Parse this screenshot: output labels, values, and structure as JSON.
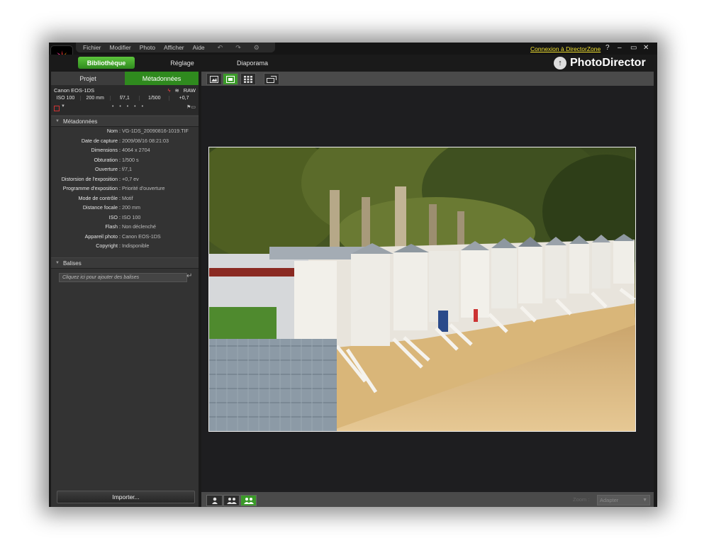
{
  "menu": [
    "Fichier",
    "Modifier",
    "Photo",
    "Afficher",
    "Aide"
  ],
  "title_link": "Connexion à DirectorZone",
  "window_controls": {
    "help": "?",
    "minimize": "–",
    "restore": "▭",
    "close": "✕"
  },
  "nav_tabs": [
    "Bibliothèque",
    "Réglage",
    "Diaporama"
  ],
  "brand": "PhotoDirector",
  "left_tabs": [
    "Projet",
    "Métadonnées"
  ],
  "camera": {
    "model": "Canon EOS-1DS",
    "format": "RAW",
    "params": [
      "ISO 100",
      "200 mm",
      "f/7,1",
      "1/500",
      "+0,7"
    ],
    "rating_dots": "• • • • •"
  },
  "sections": {
    "metadata": "Métadonnées",
    "tags": "Balises"
  },
  "metadata_rows": [
    {
      "label": "Nom :",
      "value": "VG-1DS_20090816-1019.TIF"
    },
    {
      "label": "Date de capture :",
      "value": "2009/08/16 08:21:03"
    },
    {
      "label": "Dimensions :",
      "value": "4064 x 2704"
    },
    {
      "label": "Obturation :",
      "value": "1/500 s"
    },
    {
      "label": "Ouverture :",
      "value": "f/7,1"
    },
    {
      "label": "Distorsion de l'exposition :",
      "value": "+0,7 ev"
    },
    {
      "label": "Programme d'exposition :",
      "value": "Priorité d'ouverture"
    },
    {
      "label": "Mode de contrôle :",
      "value": "Motif"
    },
    {
      "label": "Distance focale :",
      "value": "200 mm"
    },
    {
      "label": "ISO :",
      "value": "ISO 100"
    },
    {
      "label": "Flash :",
      "value": "Non déclenché"
    },
    {
      "label": "Appareil photo :",
      "value": "Canon EOS-1DS"
    },
    {
      "label": "Copyright :",
      "value": "Indisponible"
    }
  ],
  "tag_placeholder": "Cliquez ici pour ajouter des balises",
  "import_label": "Importer...",
  "zoom": {
    "label": "Zoom :",
    "value": "Adapter"
  },
  "colors": {
    "accent_green": "#3a9a28",
    "link_yellow": "#f0e030"
  },
  "icons": {
    "view_modes": [
      "compare-view-icon",
      "single-view-icon",
      "grid-view-icon"
    ],
    "toggle": "fullscreen-icon",
    "people": [
      "person-single-icon",
      "person-group-icon",
      "person-group-icon"
    ]
  }
}
